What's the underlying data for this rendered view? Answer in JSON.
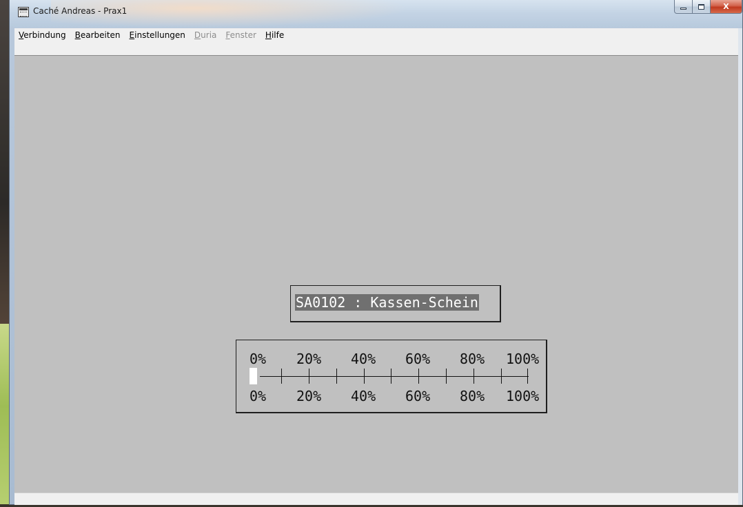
{
  "window": {
    "title": "Caché Andreas - Prax1",
    "controls": {
      "minimize": "–",
      "maximize": "□",
      "close": "X"
    }
  },
  "menubar": {
    "items": [
      {
        "label": "Verbindung",
        "enabled": true
      },
      {
        "label": "Bearbeiten",
        "enabled": true
      },
      {
        "label": "Einstellungen",
        "enabled": true
      },
      {
        "label": "Duria",
        "enabled": false
      },
      {
        "label": "Fenster",
        "enabled": false
      },
      {
        "label": "Hilfe",
        "enabled": true
      }
    ]
  },
  "terminal": {
    "form_title": "SA0102 : Kassen-Schein",
    "progress": {
      "value_percent": 0,
      "labels_top": [
        "0%",
        "20%",
        "40%",
        "60%",
        "80%",
        "100%"
      ],
      "labels_bottom": [
        "0%",
        "20%",
        "40%",
        "60%",
        "80%",
        "100%"
      ]
    }
  },
  "colors": {
    "terminal_bg": "#c0c0c0",
    "title_highlight": "#707070",
    "progress_fill": "#ffffff"
  }
}
